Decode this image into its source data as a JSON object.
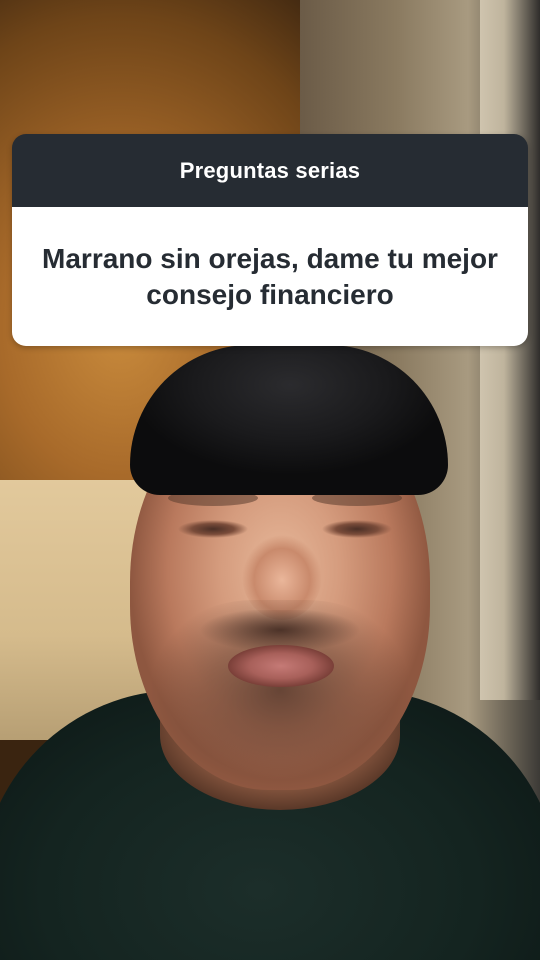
{
  "question_sticker": {
    "header": "Preguntas serias",
    "question": "Marrano sin orejas, dame tu mejor consejo financiero",
    "header_bg": "#262c33",
    "body_bg": "#ffffff",
    "text_color": "#262c33"
  },
  "background": {
    "type": "camera-selfie-photo",
    "description_icon": "person-photo"
  }
}
